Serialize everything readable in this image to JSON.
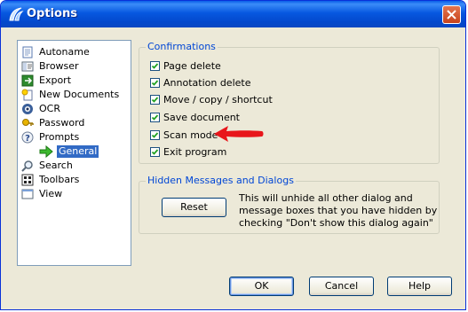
{
  "window": {
    "title": "Options",
    "accent": "#0a5ee8"
  },
  "tree": {
    "items": [
      {
        "label": "Autoname",
        "icon": "document-icon"
      },
      {
        "label": "Browser",
        "icon": "browser-icon"
      },
      {
        "label": "Export",
        "icon": "export-icon"
      },
      {
        "label": "New Documents",
        "icon": "new-document-icon"
      },
      {
        "label": "OCR",
        "icon": "ocr-icon"
      },
      {
        "label": "Password",
        "icon": "password-icon"
      },
      {
        "label": "Prompts",
        "icon": "question-icon"
      },
      {
        "label": "General",
        "icon": "green-arrow-icon",
        "selected": true
      },
      {
        "label": "Search",
        "icon": "magnifier-icon"
      },
      {
        "label": "Toolbars",
        "icon": "toolbars-icon"
      },
      {
        "label": "View",
        "icon": "view-icon"
      }
    ]
  },
  "confirmations": {
    "title": "Confirmations",
    "items": [
      {
        "label": "Page delete",
        "checked": true
      },
      {
        "label": "Annotation delete",
        "checked": true
      },
      {
        "label": "Move / copy / shortcut",
        "checked": true
      },
      {
        "label": "Save document",
        "checked": true
      },
      {
        "label": "Scan mode",
        "checked": true
      },
      {
        "label": "Exit program",
        "checked": true
      }
    ]
  },
  "hidden": {
    "title": "Hidden Messages and Dialogs",
    "reset_label": "Reset",
    "lines": [
      "This will unhide all other dialog and",
      "message boxes that you have hidden by",
      "checking \"Don't show this dialog again\""
    ]
  },
  "buttons": {
    "ok": "OK",
    "cancel": "Cancel",
    "help": "Help"
  },
  "annotation": {
    "arrow_color": "#e8161b"
  }
}
